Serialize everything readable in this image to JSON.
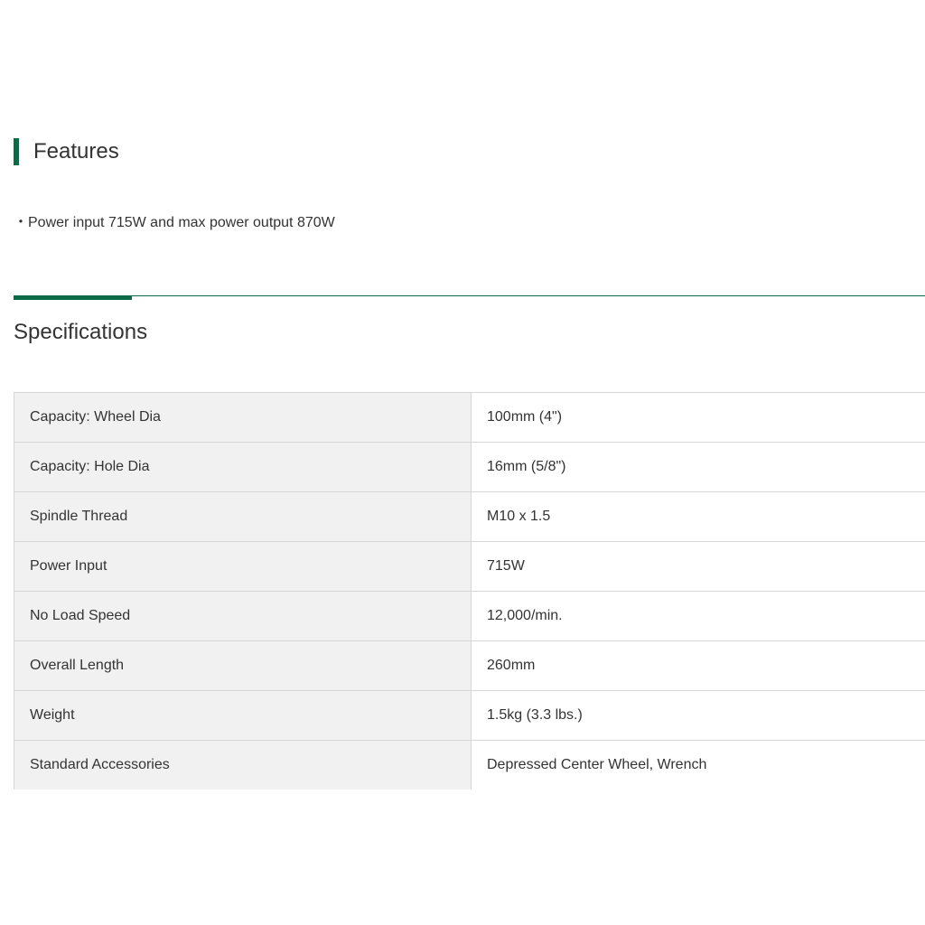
{
  "features": {
    "title": "Features",
    "items": [
      "・Power input 715W and max power output 870W"
    ]
  },
  "specifications": {
    "title": "Specifications",
    "rows": [
      {
        "label": "Capacity: Wheel Dia",
        "value": "100mm (4\")"
      },
      {
        "label": "Capacity: Hole Dia",
        "value": "16mm (5/8\")"
      },
      {
        "label": "Spindle Thread",
        "value": "M10 x 1.5"
      },
      {
        "label": "Power Input",
        "value": "715W"
      },
      {
        "label": "No Load Speed",
        "value": "12,000/min."
      },
      {
        "label": "Overall Length",
        "value": "260mm"
      },
      {
        "label": "Weight",
        "value": "1.5kg (3.3 lbs.)"
      },
      {
        "label": "Standard Accessories",
        "value": "Depressed Center Wheel, Wrench"
      }
    ]
  },
  "colors": {
    "accent": "#0b6b46",
    "label_cell_bg": "#f1f1f1",
    "border": "#d6d6d6",
    "text": "#333333"
  }
}
